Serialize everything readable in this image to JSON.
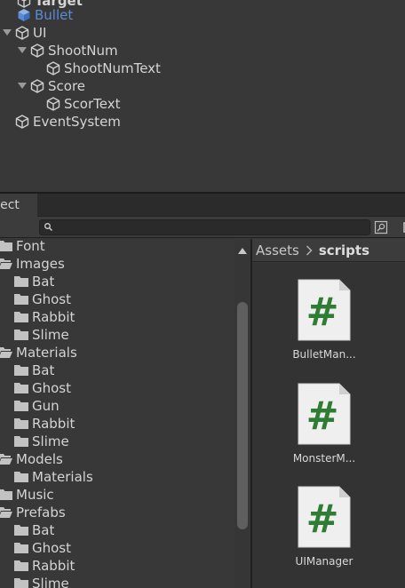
{
  "hierarchy": {
    "items": [
      {
        "label": "Target"
      },
      {
        "label": "Bullet"
      },
      {
        "label": "UI"
      },
      {
        "label": "ShootNum"
      },
      {
        "label": "ShootNumText"
      },
      {
        "label": "Score"
      },
      {
        "label": "ScorText"
      },
      {
        "label": "EventSystem"
      }
    ]
  },
  "project": {
    "tab_label": "Project",
    "search": {
      "value": "",
      "placeholder": ""
    },
    "tree": [
      {
        "label": "Font"
      },
      {
        "label": "Images"
      },
      {
        "label": "Bat"
      },
      {
        "label": "Ghost"
      },
      {
        "label": "Rabbit"
      },
      {
        "label": "Slime"
      },
      {
        "label": "Materials"
      },
      {
        "label": "Bat"
      },
      {
        "label": "Ghost"
      },
      {
        "label": "Gun"
      },
      {
        "label": "Rabbit"
      },
      {
        "label": "Slime"
      },
      {
        "label": "Models"
      },
      {
        "label": "Materials"
      },
      {
        "label": "Music"
      },
      {
        "label": "Prefabs"
      },
      {
        "label": "Bat"
      },
      {
        "label": "Ghost"
      },
      {
        "label": "Rabbit"
      },
      {
        "label": "Slime"
      }
    ],
    "breadcrumb": {
      "root": "Assets",
      "current": "scripts"
    },
    "assets": [
      {
        "label": "BulletMan...",
        "icon": "csharp-script-icon"
      },
      {
        "label": "MonsterM...",
        "icon": "csharp-script-icon"
      },
      {
        "label": "UIManager",
        "icon": "csharp-script-icon"
      }
    ]
  },
  "colors": {
    "panel_bg": "#383838",
    "selected_text": "#5b8bd6",
    "script_hash": "#2e7d32"
  }
}
